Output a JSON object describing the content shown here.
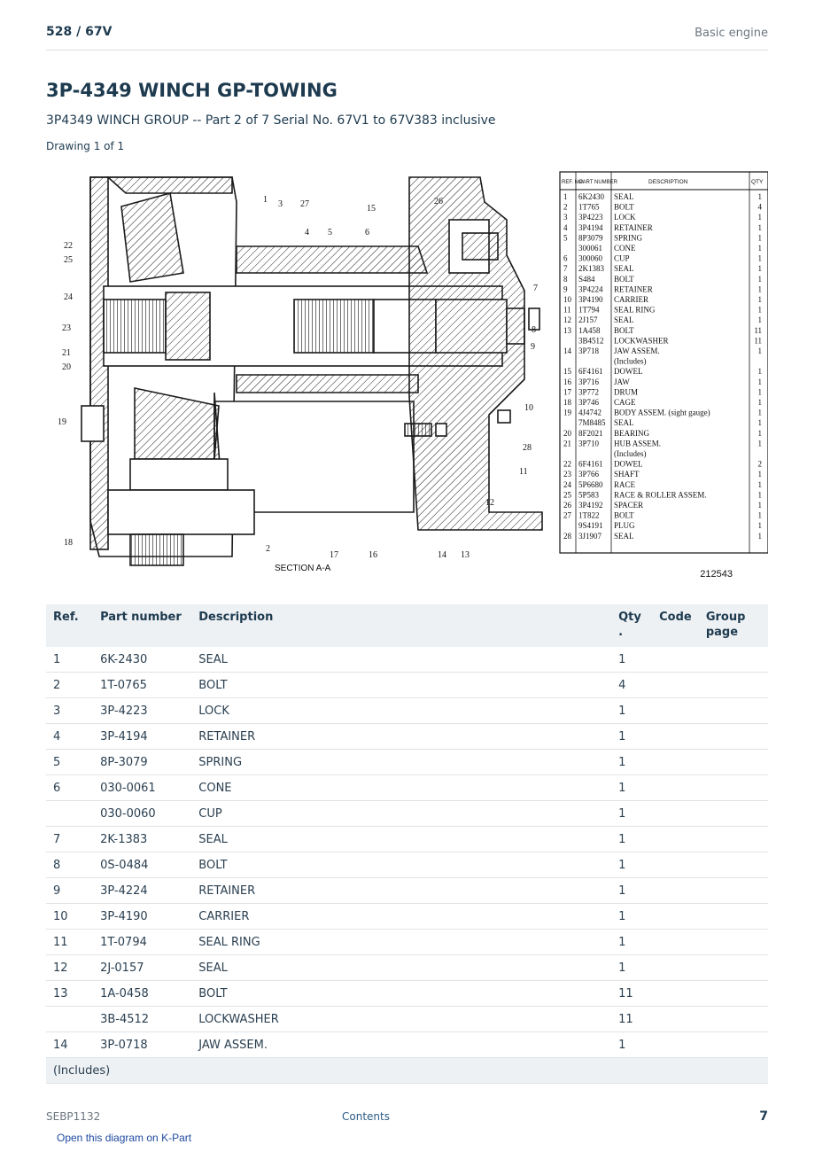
{
  "header": {
    "crumb": "528  /  67V",
    "section": "Basic engine"
  },
  "title": "3P-4349 WINCH GP-TOWING",
  "subtitle": "3P4349 WINCH GROUP -- Part 2 of 7 Serial No. 67V1 to 67V383 inclusive",
  "drawing_label": "Drawing 1 of 1",
  "figure": {
    "section_label": "SECTION A-A",
    "drawing_number": "212543",
    "callouts": [
      "1",
      "3",
      "27",
      "15",
      "26",
      "22",
      "25",
      "24",
      "23",
      "21",
      "20",
      "19",
      "4",
      "5",
      "6",
      "7",
      "8",
      "9",
      "10",
      "28",
      "11",
      "12",
      "18",
      "2",
      "17",
      "16",
      "14",
      "13"
    ],
    "legend_headers": {
      "ref": "REF. NO.",
      "part": "PART NUMBER",
      "desc": "DESCRIPTION",
      "qty": "QTY"
    },
    "legend_rows": [
      {
        "ref": "1",
        "part": "6K2430",
        "desc": "SEAL",
        "qty": "1"
      },
      {
        "ref": "2",
        "part": "1T765",
        "desc": "BOLT",
        "qty": "4"
      },
      {
        "ref": "3",
        "part": "3P4223",
        "desc": "LOCK",
        "qty": "1"
      },
      {
        "ref": "4",
        "part": "3P4194",
        "desc": "RETAINER",
        "qty": "1"
      },
      {
        "ref": "5",
        "part": "8P3079",
        "desc": "SPRING",
        "qty": "1"
      },
      {
        "ref": "",
        "part": "300061",
        "desc": "CONE",
        "qty": "1"
      },
      {
        "ref": "6",
        "part": "300060",
        "desc": "CUP",
        "qty": "1"
      },
      {
        "ref": "7",
        "part": "2K1383",
        "desc": "SEAL",
        "qty": "1"
      },
      {
        "ref": "8",
        "part": "S484",
        "desc": "BOLT",
        "qty": "1"
      },
      {
        "ref": "9",
        "part": "3P4224",
        "desc": "RETAINER",
        "qty": "1"
      },
      {
        "ref": "10",
        "part": "3P4190",
        "desc": "CARRIER",
        "qty": "1"
      },
      {
        "ref": "11",
        "part": "1T794",
        "desc": "SEAL RING",
        "qty": "1"
      },
      {
        "ref": "12",
        "part": "2J157",
        "desc": "SEAL",
        "qty": "1"
      },
      {
        "ref": "13",
        "part": "1A458",
        "desc": "BOLT",
        "qty": "11"
      },
      {
        "ref": "",
        "part": "3B4512",
        "desc": "LOCKWASHER",
        "qty": "11"
      },
      {
        "ref": "14",
        "part": "3P718",
        "desc": "JAW ASSEM.",
        "qty": "1"
      },
      {
        "ref": "",
        "part": "",
        "desc": "(Includes)",
        "qty": ""
      },
      {
        "ref": "15",
        "part": "6F4161",
        "desc": "DOWEL",
        "qty": "1"
      },
      {
        "ref": "16",
        "part": "3P716",
        "desc": "JAW",
        "qty": "1"
      },
      {
        "ref": "17",
        "part": "3P772",
        "desc": "DRUM",
        "qty": "1"
      },
      {
        "ref": "18",
        "part": "3P746",
        "desc": "CAGE",
        "qty": "1"
      },
      {
        "ref": "19",
        "part": "4J4742",
        "desc": "BODY ASSEM. (sight gauge)",
        "qty": "1"
      },
      {
        "ref": "",
        "part": "7M8485",
        "desc": "SEAL",
        "qty": "1"
      },
      {
        "ref": "20",
        "part": "8F2021",
        "desc": "BEARING",
        "qty": "1"
      },
      {
        "ref": "21",
        "part": "3P710",
        "desc": "HUB ASSEM.",
        "qty": "1"
      },
      {
        "ref": "",
        "part": "",
        "desc": "(Includes)",
        "qty": ""
      },
      {
        "ref": "22",
        "part": "6F4161",
        "desc": "DOWEL",
        "qty": "2"
      },
      {
        "ref": "23",
        "part": "3P766",
        "desc": "SHAFT",
        "qty": "1"
      },
      {
        "ref": "24",
        "part": "5P6680",
        "desc": "RACE",
        "qty": "1"
      },
      {
        "ref": "25",
        "part": "5P583",
        "desc": "RACE & ROLLER ASSEM.",
        "qty": "1"
      },
      {
        "ref": "26",
        "part": "3P4192",
        "desc": "SPACER",
        "qty": "1"
      },
      {
        "ref": "27",
        "part": "1T822",
        "desc": "BOLT",
        "qty": "1"
      },
      {
        "ref": "",
        "part": "9S4191",
        "desc": "PLUG",
        "qty": "1"
      },
      {
        "ref": "28",
        "part": "3J1907",
        "desc": "SEAL",
        "qty": "1"
      }
    ]
  },
  "table": {
    "headers": {
      "ref": "Ref.",
      "part_number": "Part number",
      "description": "Description",
      "qty": "Qty\n.",
      "code": "Code",
      "group_page": "Group\npage"
    },
    "rows": [
      {
        "ref": "1",
        "part_number": "6K-2430",
        "description": "SEAL",
        "qty": "1"
      },
      {
        "ref": "2",
        "part_number": "1T-0765",
        "description": "BOLT",
        "qty": "4"
      },
      {
        "ref": "3",
        "part_number": "3P-4223",
        "description": "LOCK",
        "qty": "1"
      },
      {
        "ref": "4",
        "part_number": "3P-4194",
        "description": "RETAINER",
        "qty": "1"
      },
      {
        "ref": "5",
        "part_number": "8P-3079",
        "description": "SPRING",
        "qty": "1"
      },
      {
        "ref": "6",
        "part_number": "030-0061",
        "description": "CONE",
        "qty": "1"
      },
      {
        "ref": "",
        "part_number": "030-0060",
        "description": "CUP",
        "qty": "1"
      },
      {
        "ref": "7",
        "part_number": "2K-1383",
        "description": "SEAL",
        "qty": "1"
      },
      {
        "ref": "8",
        "part_number": "0S-0484",
        "description": "BOLT",
        "qty": "1"
      },
      {
        "ref": "9",
        "part_number": "3P-4224",
        "description": "RETAINER",
        "qty": "1"
      },
      {
        "ref": "10",
        "part_number": "3P-4190",
        "description": "CARRIER",
        "qty": "1"
      },
      {
        "ref": "11",
        "part_number": "1T-0794",
        "description": "SEAL RING",
        "qty": "1"
      },
      {
        "ref": "12",
        "part_number": "2J-0157",
        "description": "SEAL",
        "qty": "1"
      },
      {
        "ref": "13",
        "part_number": "1A-0458",
        "description": "BOLT",
        "qty": "11"
      },
      {
        "ref": "",
        "part_number": "3B-4512",
        "description": "LOCKWASHER",
        "qty": "11"
      },
      {
        "ref": "14",
        "part_number": "3P-0718",
        "description": "JAW ASSEM.",
        "qty": "1"
      }
    ],
    "note": "(Includes)"
  },
  "footer": {
    "doc_id": "SEBP1132",
    "contents_link": "Contents",
    "page": "7",
    "kpart_link": "Open this diagram on K-Part"
  }
}
